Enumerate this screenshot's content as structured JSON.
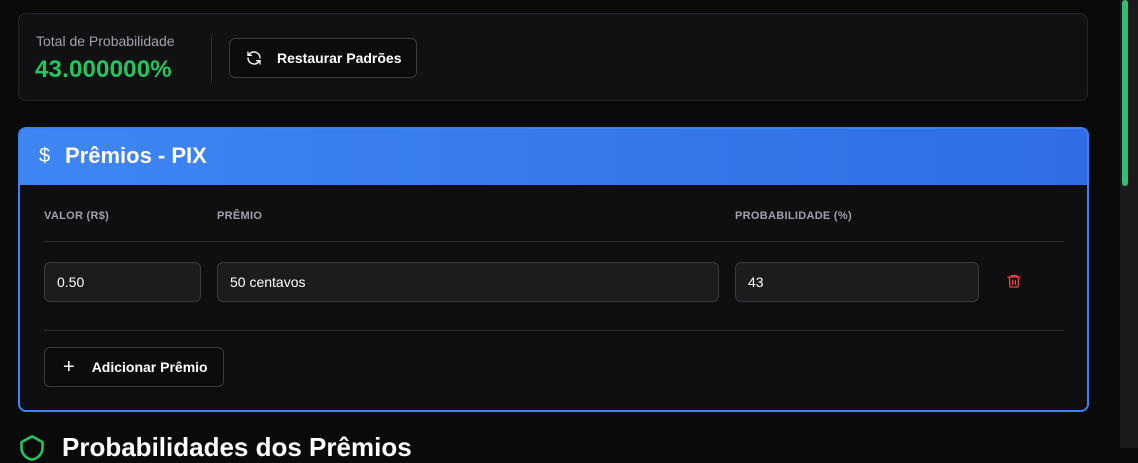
{
  "summary": {
    "total_label": "Total de Probabilidade",
    "total_value": "43.000000%",
    "restore_label": "Restaurar Padrões"
  },
  "prizes_section": {
    "icon": "dollar-icon",
    "title": "Prêmios - PIX",
    "columns": [
      "VALOR (R$)",
      "PRÊMIO",
      "PROBABILIDADE (%)"
    ],
    "rows": [
      {
        "valor": "0.50",
        "premio": "50 centavos",
        "probabilidade": "43"
      }
    ],
    "add_label": "Adicionar Prêmio"
  },
  "next_section": {
    "title": "Probabilidades dos Prêmios"
  },
  "colors": {
    "accent": "#3b82f6",
    "success": "#22c55e",
    "danger": "#ef4444"
  }
}
